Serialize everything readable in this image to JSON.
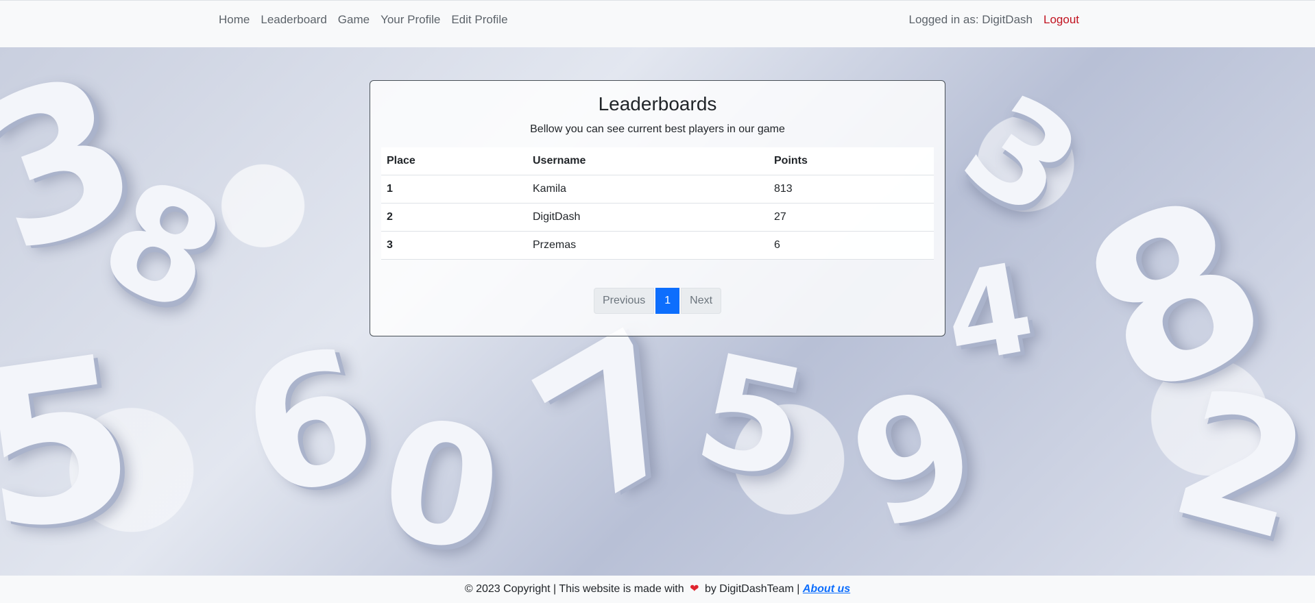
{
  "nav": {
    "links": [
      "Home",
      "Leaderboard",
      "Game",
      "Your Profile",
      "Edit Profile"
    ],
    "logged_in_text": "Logged in as: DigitDash",
    "logout_label": "Logout"
  },
  "card": {
    "title": "Leaderboards",
    "subtitle": "Bellow you can see current best players in our game",
    "table": {
      "headers": [
        "Place",
        "Username",
        "Points"
      ],
      "rows": [
        [
          "1",
          "Kamila",
          "813"
        ],
        [
          "2",
          "DigitDash",
          "27"
        ],
        [
          "3",
          "Przemas",
          "6"
        ]
      ]
    },
    "pagination": {
      "previous_label": "Previous",
      "current_page": "1",
      "next_label": "Next"
    }
  },
  "footer": {
    "text_before": "© 2023 Copyright | This website is made with",
    "heart": "❤",
    "text_after": "by DigitDashTeam |",
    "about_label": "About us"
  },
  "colors": {
    "accent": "#0d6efd",
    "logout": "#c1121f",
    "heart": "#e0242f"
  }
}
